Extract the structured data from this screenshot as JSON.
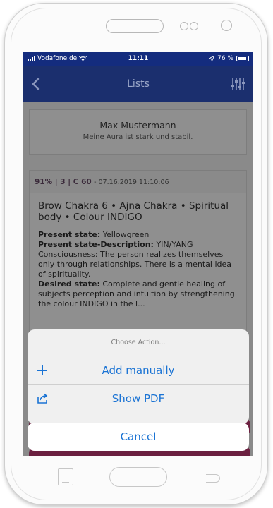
{
  "status_bar": {
    "carrier": "Vodafone.de",
    "time": "11:11",
    "battery": "76 %",
    "icons": [
      "signal-icon",
      "wifi-icon",
      "location-arrow-icon",
      "battery-icon"
    ]
  },
  "nav": {
    "title": "Lists",
    "icons": [
      "back-chevron-icon",
      "sliders-icon"
    ]
  },
  "profile_card": {
    "name": "Max Mustermann",
    "subtitle": "Meine Aura ist stark und stabil."
  },
  "entry": {
    "header_stats": "91% | 3 | C 60",
    "timestamp": "- 07.16.2019 11:10:06",
    "title": "Brow Chakra 6 • Ajna Chakra • Spiritual body • Colour INDIGO",
    "present_state_label": "Present state:",
    "present_state_value": "Yellowgreen",
    "present_desc_label": "Present state-Description:",
    "present_desc_value": "YIN/YANG",
    "description": "Consciousness: The person realizes themselves only through relationships. There is a mental idea of spirituality.",
    "desired_state_label": "Desired state:",
    "desired_state_value": "Complete and gentle healing of subjects perception and intuition by strengthening the colour INDIGO in the l..."
  },
  "action_sheet": {
    "title": "Choose Action...",
    "items": [
      {
        "label": "Add manually",
        "icon": "plus-icon"
      },
      {
        "label": "Show PDF",
        "icon": "share-icon"
      }
    ],
    "cancel_label": "Cancel"
  },
  "colors": {
    "navbar": "#1b2f6e",
    "overlay": "#8a8a8a",
    "action_blue": "#1a73d4",
    "purple_button": "#6b2040"
  }
}
